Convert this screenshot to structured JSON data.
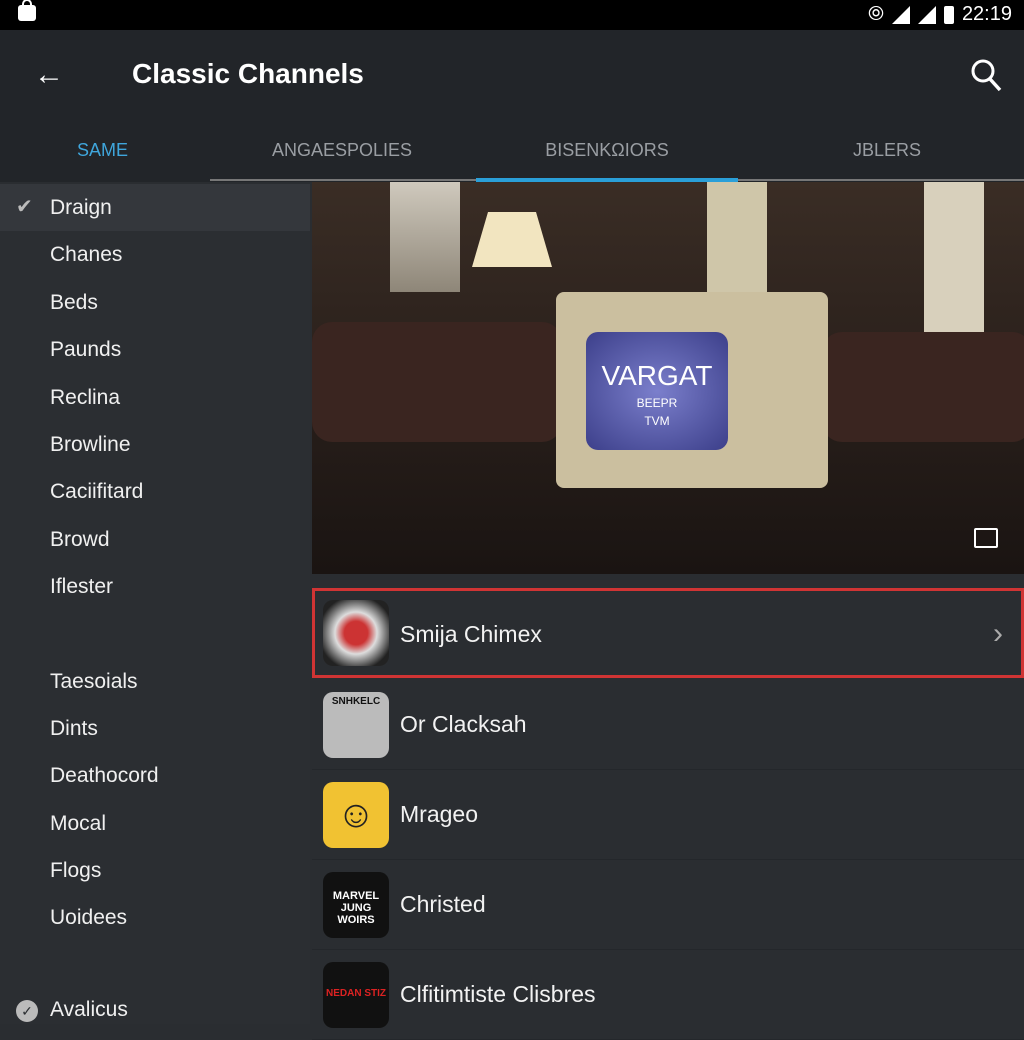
{
  "status_bar": {
    "time": "22:19",
    "icons": [
      "lock-icon",
      "vibrate-icon",
      "wifi-icon",
      "signal-icon",
      "battery-icon"
    ]
  },
  "app_bar": {
    "title": "Classic Channels",
    "back_icon": "arrow-left-icon",
    "search_icon": "search-icon"
  },
  "tabs": [
    {
      "label": "SAME",
      "selected": true
    },
    {
      "label": "ANGAESPOLIES"
    },
    {
      "label": "BISENKΩIORS",
      "indicator": true
    },
    {
      "label": "JBLERS"
    }
  ],
  "colors": {
    "accent": "#2a9fd8",
    "highlight": "#d03434"
  },
  "sidebar": {
    "items": [
      {
        "label": "Draign",
        "checked": true
      },
      {
        "label": "Chanes"
      },
      {
        "label": "Beds"
      },
      {
        "label": "Paunds"
      },
      {
        "label": "Reclina"
      },
      {
        "label": "Browline"
      },
      {
        "label": "Caciifitard"
      },
      {
        "label": "Browd"
      },
      {
        "label": "Iflester"
      },
      {
        "label": "Taesoials"
      },
      {
        "label": "Dints"
      },
      {
        "label": "Deathocord"
      },
      {
        "label": "Mocal"
      },
      {
        "label": "Flogs"
      },
      {
        "label": "Uoidees"
      },
      {
        "label": "Avalicus",
        "check_circle": true
      }
    ]
  },
  "video": {
    "screen_title": "VARGAT",
    "screen_sub1": "BEEPR",
    "screen_sub2": "TVM"
  },
  "channels": [
    {
      "name": "Smija Chimex",
      "highlighted": true,
      "thumb_text": ""
    },
    {
      "name": "Or Clacksah",
      "thumb_text": "SNHKELC"
    },
    {
      "name": "Mrageo",
      "thumb_text": ""
    },
    {
      "name": "Christed",
      "thumb_text": "MARVEL JUNG WOIRS"
    },
    {
      "name": "Clfitimtiste Clisbres",
      "thumb_text": "NEDAN STIZ"
    }
  ]
}
